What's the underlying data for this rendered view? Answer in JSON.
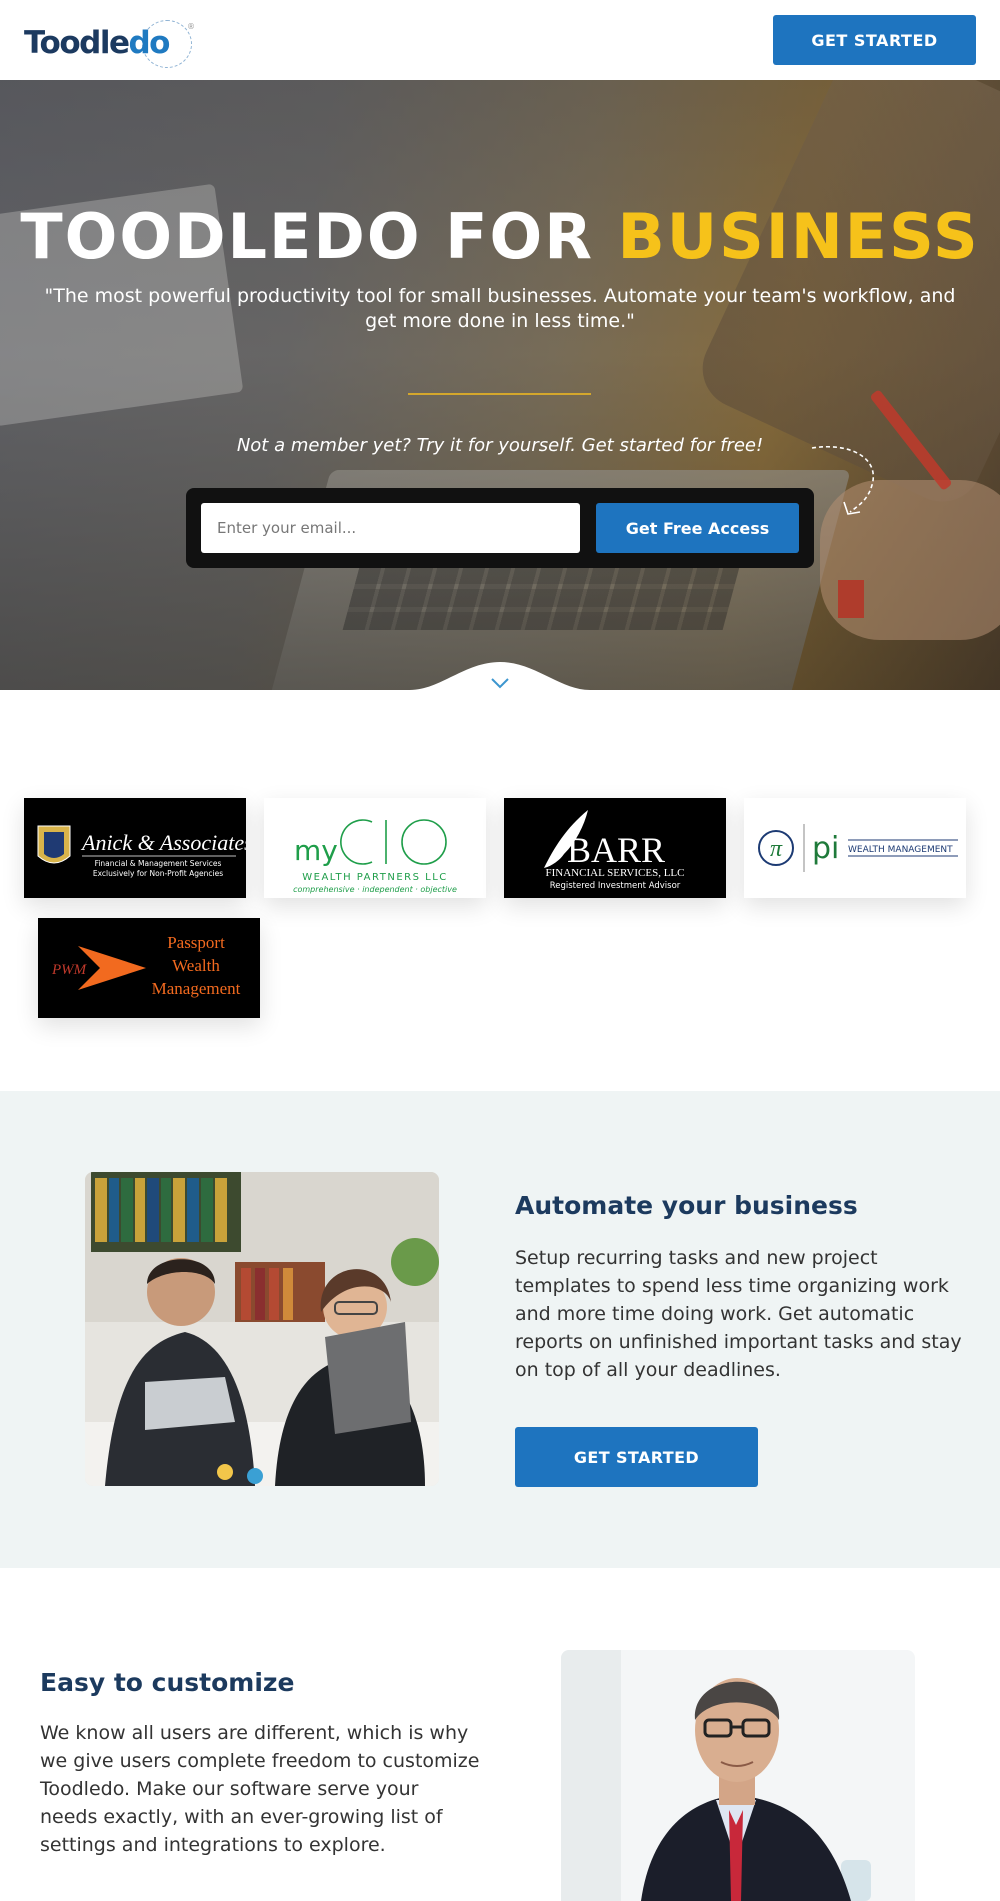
{
  "header": {
    "logo_text_main": "Toodle",
    "logo_text_accent": "do",
    "logo_reg": "®",
    "cta_label": "GET STARTED"
  },
  "hero": {
    "title_main": "TOODLEDO FOR ",
    "title_accent": "BUSINESS",
    "subtitle": "\"The most powerful productivity tool for small businesses. Automate your team's workflow, and get more done in less time.\"",
    "prompt": "Not a member yet? Try it for yourself. Get started for free!",
    "email_placeholder": "Enter your email...",
    "submit_label": "Get Free Access"
  },
  "clients": [
    {
      "name": "Anick & Associates",
      "tagline": "Financial & Management Services",
      "tagline2": "Exclusively for Non-Profit Agencies"
    },
    {
      "name": "myCIO",
      "line1": "WEALTH PARTNERS LLC",
      "line2": "comprehensive · independent · objective"
    },
    {
      "name": "BARR",
      "line1": "FINANCIAL SERVICES, LLC",
      "line2": "Registered Investment Advisor"
    },
    {
      "name": "pi",
      "line1": "WEALTH MANAGEMENT"
    },
    {
      "name": "PWM",
      "line1": "Passport",
      "line2": "Wealth",
      "line3": "Management"
    }
  ],
  "automate": {
    "title": "Automate your business",
    "body": "Setup recurring tasks and new project templates to spend less time organizing work and more time doing work. Get automatic reports on unfinished important tasks and stay on top of all your deadlines.",
    "cta_label": "GET STARTED"
  },
  "customize": {
    "title": "Easy to customize",
    "body": "We know all users are different, which is why we give users complete freedom to customize Toodledo. Make our software serve your needs exactly, with an ever-growing list of settings and integrations to explore."
  },
  "colors": {
    "brand_blue": "#1e74bf",
    "accent_yellow": "#f6c21a",
    "navy": "#1c3a5e",
    "section_bg": "#eff4f4"
  }
}
